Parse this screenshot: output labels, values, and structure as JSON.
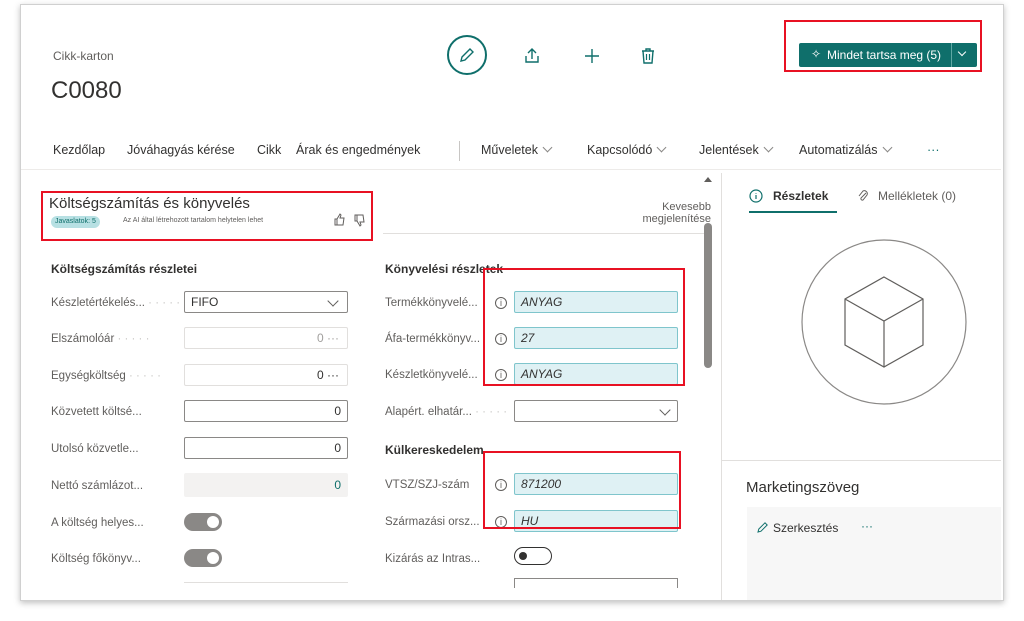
{
  "header": {
    "breadcrumb": "Cikk-karton",
    "title": "C0080",
    "keep_all_label": "Mindet tartsa meg (5)"
  },
  "nav": {
    "items": [
      "Kezdőlap",
      "Jóváhagyás kérése",
      "Cikk",
      "Árak és engedmények",
      "Műveletek",
      "Kapcsolódó",
      "Jelentések",
      "Automatizálás"
    ],
    "more": "···"
  },
  "section": {
    "title": "Költségszámítás és könyvelés",
    "suggestion_badge": "Javaslatok: 5",
    "ai_disclaimer": "Az AI által létrehozott tartalom helytelen lehet",
    "show_less": [
      "Kevesebb",
      "megjelenítése"
    ]
  },
  "costing": {
    "heading": "Költségszámítás részletei",
    "fields": [
      {
        "label": "Készletértékelés...",
        "value": "FIFO"
      },
      {
        "label": "Elszámolóár",
        "value": "0 ···"
      },
      {
        "label": "Egységköltség",
        "value": "0 ···"
      },
      {
        "label": "Közvetett költsé...",
        "value": "0"
      },
      {
        "label": "Utolsó közvetle...",
        "value": "0"
      },
      {
        "label": "Nettó számlázot...",
        "value": "0"
      },
      {
        "label": "A költség helyes...",
        "value": ""
      },
      {
        "label": "Költség főkönyv...",
        "value": ""
      }
    ]
  },
  "posting": {
    "heading": "Könyvelési részletek",
    "fields": [
      {
        "label": "Termékkönyvelé...",
        "value": "ANYAG"
      },
      {
        "label": "Áfa-termékkönyv...",
        "value": "27"
      },
      {
        "label": "Készletkönyvelé...",
        "value": "ANYAG"
      },
      {
        "label": "Alapért. elhatár...",
        "value": ""
      }
    ]
  },
  "foreign_trade": {
    "heading": "Külkereskedelem",
    "fields": [
      {
        "label": "VTSZ/SZJ-szám",
        "value": "871200"
      },
      {
        "label": "Származási orsz...",
        "value": "HU"
      },
      {
        "label": "Kizárás az Intras...",
        "value": ""
      }
    ]
  },
  "factbox": {
    "tab_details": "Részletek",
    "tab_attachments": "Mellékletek (0)",
    "marketing_title": "Marketingszöveg",
    "edit_label": "Szerkesztés",
    "more": "···"
  },
  "colors": {
    "accent": "#0f6f6b",
    "ai_field": "#dff1f4",
    "highlight": "#e81123"
  }
}
